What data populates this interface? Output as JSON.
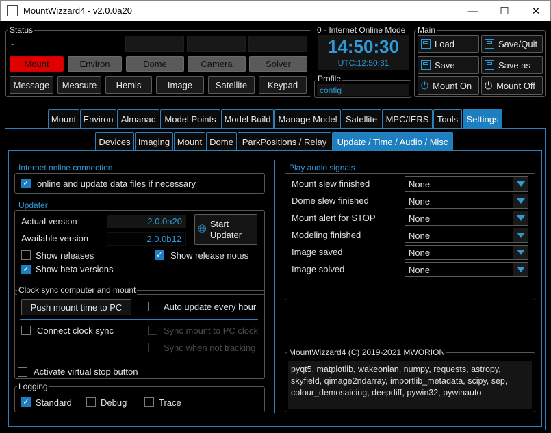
{
  "window": {
    "title": "MountWizzard4 - v2.0.0a20",
    "controls": {
      "minimize": "—",
      "maximize": "☐",
      "close": "✕"
    }
  },
  "status": {
    "label": "Status",
    "dash": "-",
    "devices": [
      "Mount",
      "Environ",
      "Dome",
      "Camera",
      "Solver"
    ],
    "tools": [
      "Message",
      "Measure",
      "Hemis",
      "Image",
      "Satellite",
      "Keypad"
    ]
  },
  "clock": {
    "mode": "0 - Internet Online Mode",
    "time": "14:50:30",
    "utc": "UTC:12:50:31"
  },
  "profile": {
    "label": "Profile",
    "value": "config"
  },
  "main": {
    "label": "Main",
    "load": "Load",
    "save_quit": "Save/Quit",
    "save": "Save",
    "save_as": "Save as",
    "mount_on": "Mount On",
    "mount_off": "Mount Off"
  },
  "tabs": [
    "Mount",
    "Environ",
    "Almanac",
    "Model Points",
    "Model Build",
    "Manage Model",
    "Satellite",
    "MPC/IERS",
    "Tools",
    "Settings"
  ],
  "subtabs": [
    "Devices",
    "Imaging",
    "Mount",
    "Dome",
    "ParkPositions / Relay",
    "Update / Time / Audio / Misc"
  ],
  "internet": {
    "title": "Internet online connection",
    "checkbox": "online and update data files if necessary"
  },
  "updater": {
    "title": "Updater",
    "actual_label": "Actual version",
    "actual_value": "2.0.0a20",
    "available_label": "Available version",
    "available_value": "2.0.0b12",
    "start_line1": "Start",
    "start_line2": "Updater",
    "show_releases": "Show releases",
    "show_release_notes": "Show release notes",
    "show_beta": "Show beta versions"
  },
  "clocksync": {
    "title": "Clock sync computer and mount",
    "push": "Push mount time to PC",
    "auto_update": "Auto update every hour",
    "connect": "Connect clock sync",
    "sync_mount": "Sync mount to PC clock",
    "sync_not_tracking": "Sync when not tracking"
  },
  "virtual_stop": "Activate virtual stop button",
  "logging": {
    "title": "Logging",
    "standard": "Standard",
    "debug": "Debug",
    "trace": "Trace"
  },
  "audio": {
    "title": "Play audio signals",
    "rows": [
      {
        "label": "Mount slew finished",
        "value": "None"
      },
      {
        "label": "Dome slew finished",
        "value": "None"
      },
      {
        "label": "Mount alert for STOP",
        "value": "None"
      },
      {
        "label": "Modeling finished",
        "value": "None"
      },
      {
        "label": "Image saved",
        "value": "None"
      },
      {
        "label": "Image solved",
        "value": "None"
      }
    ]
  },
  "about": {
    "title": "MountWizzard4 (C) 2019-2021 MWORION",
    "line1": "pyqt5, matplotlib, wakeonlan, numpy, requests, astropy,",
    "line2": "skyfield, qimage2ndarray, importlib_metadata, scipy, sep,",
    "line3": "colour_demosaicing, deepdiff, pywin32, pywinauto"
  },
  "colors": {
    "accent": "#1d7fc0",
    "alert": "#e00000",
    "text_blue": "#2e9ad8"
  }
}
